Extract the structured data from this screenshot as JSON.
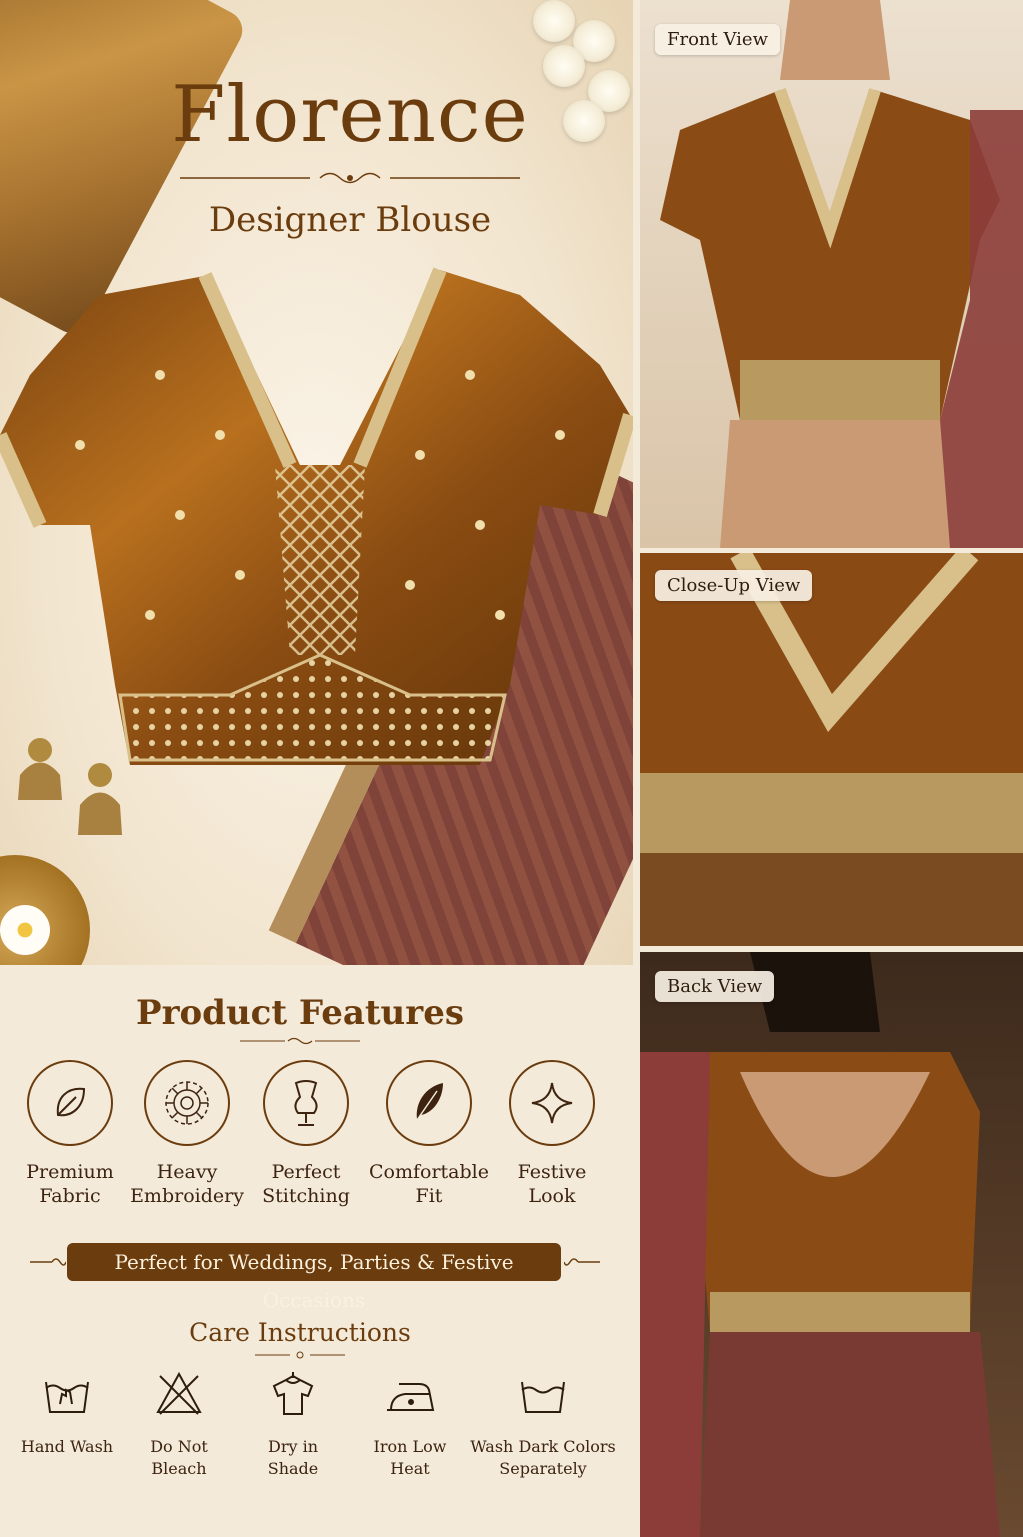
{
  "brand": {
    "title": "Florence",
    "subtitle": "Designer Blouse"
  },
  "features": {
    "title": "Product Features",
    "items": [
      {
        "label_line1": "Premium",
        "label_line2": "Fabric",
        "icon": "leaf-icon"
      },
      {
        "label_line1": "Heavy",
        "label_line2": "Embroidery",
        "icon": "mandala-icon"
      },
      {
        "label_line1": "Perfect",
        "label_line2": "Stitching",
        "icon": "dress-form-icon"
      },
      {
        "label_line1": "Comfortable",
        "label_line2": "Fit",
        "icon": "feather-icon"
      },
      {
        "label_line1": "Festive",
        "label_line2": "Look",
        "icon": "sparkle-icon"
      }
    ]
  },
  "occasion": "Perfect for Weddings, Parties & Festive Occasions",
  "care": {
    "title": "Care Instructions",
    "items": [
      {
        "label_line1": "Hand Wash",
        "label_line2": "",
        "icon": "hand-wash-icon"
      },
      {
        "label_line1": "Do Not",
        "label_line2": "Bleach",
        "icon": "no-bleach-icon"
      },
      {
        "label_line1": "Dry in",
        "label_line2": "Shade",
        "icon": "dry-shade-icon"
      },
      {
        "label_line1": "Iron Low",
        "label_line2": "Heat",
        "icon": "iron-low-icon"
      },
      {
        "label_line1": "Wash Dark Colors",
        "label_line2": "Separately",
        "icon": "wash-dark-icon"
      }
    ]
  },
  "views": {
    "front": "Front View",
    "closeup": "Close-Up View",
    "back": "Back View"
  },
  "colors": {
    "brand_brown": "#6b3c0e",
    "cream": "#f3ead9",
    "gold": "#c99a4a",
    "maroon": "#7a3b32"
  }
}
